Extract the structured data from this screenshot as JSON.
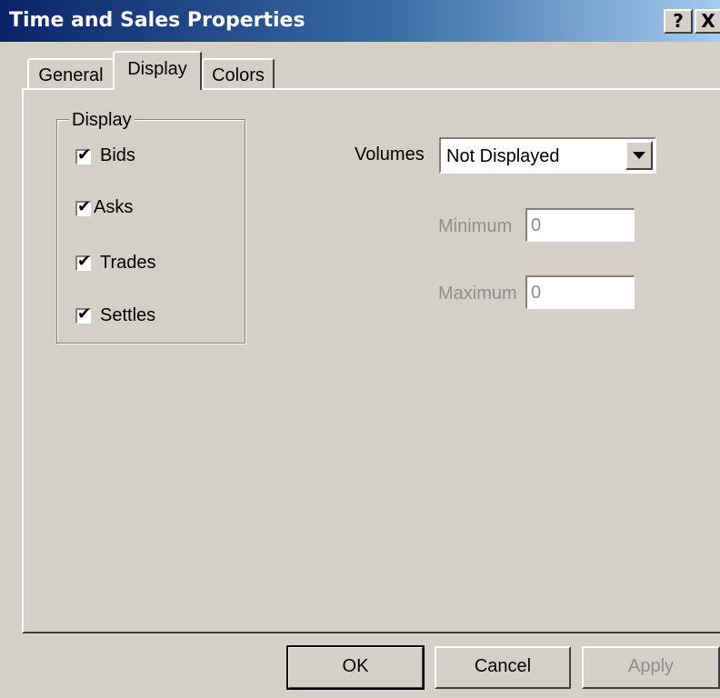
{
  "window": {
    "title": "Time and Sales Properties",
    "help_label": "?",
    "close_label": "X"
  },
  "tabs": [
    {
      "label": "General",
      "selected": false
    },
    {
      "label": "Display",
      "selected": true
    },
    {
      "label": "Colors",
      "selected": false
    }
  ],
  "display_group": {
    "legend": "Display",
    "items": [
      {
        "label": "Bids",
        "checked": true
      },
      {
        "label": "Asks",
        "checked": true
      },
      {
        "label": "Trades",
        "checked": true
      },
      {
        "label": "Settles",
        "checked": true
      }
    ]
  },
  "volumes": {
    "label": "Volumes",
    "selected": "Not Displayed"
  },
  "minimum": {
    "label": "Minimum",
    "value": "0",
    "enabled": false
  },
  "maximum": {
    "label": "Maximum",
    "value": "0",
    "enabled": false
  },
  "buttons": {
    "ok": "OK",
    "cancel": "Cancel",
    "apply": "Apply"
  },
  "check_glyph": "✔"
}
